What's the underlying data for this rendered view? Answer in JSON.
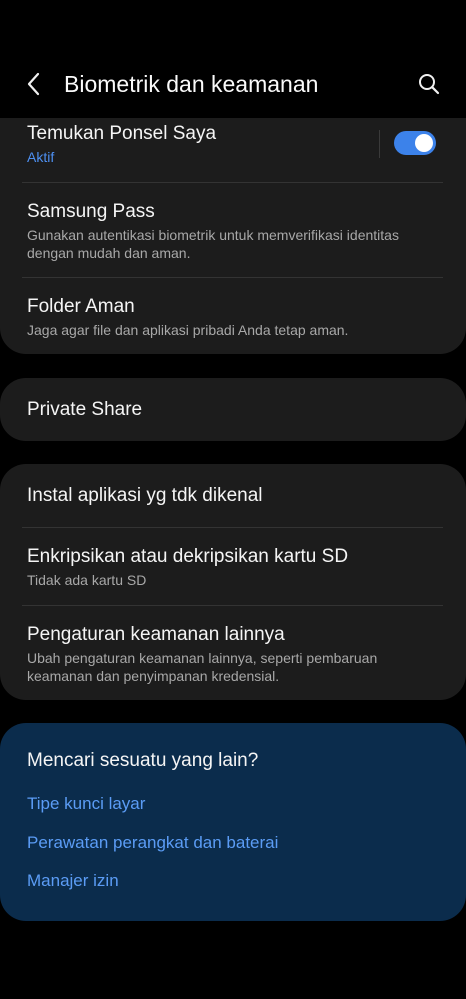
{
  "header": {
    "title": "Biometrik dan keamanan"
  },
  "card1": {
    "find_phone": {
      "title": "Temukan Ponsel Saya",
      "status": "Aktif",
      "enabled": true
    },
    "samsung_pass": {
      "title": "Samsung Pass",
      "subtitle": "Gunakan autentikasi biometrik untuk memverifikasi identitas dengan mudah dan aman."
    },
    "secure_folder": {
      "title": "Folder Aman",
      "subtitle": "Jaga agar file dan aplikasi pribadi Anda tetap aman."
    }
  },
  "card2": {
    "private_share": {
      "title": "Private Share"
    }
  },
  "card3": {
    "install_unknown": {
      "title": "Instal aplikasi yg tdk dikenal"
    },
    "encrypt_sd": {
      "title": "Enkripsikan atau dekripsikan kartu SD",
      "subtitle": "Tidak ada kartu SD"
    },
    "other_security": {
      "title": "Pengaturan keamanan lainnya",
      "subtitle": "Ubah pengaturan keamanan lainnya, seperti pembaruan keamanan dan penyimpanan kredensial."
    }
  },
  "looking_for": {
    "title": "Mencari sesuatu yang lain?",
    "links": [
      {
        "label": "Tipe kunci layar"
      },
      {
        "label": "Perawatan perangkat dan baterai"
      },
      {
        "label": "Manajer izin"
      }
    ]
  },
  "colors": {
    "accent": "#3c82ea",
    "link": "#5b9cf5",
    "card": "#1c1c1c",
    "suggestion_card": "#0b2c4c"
  }
}
